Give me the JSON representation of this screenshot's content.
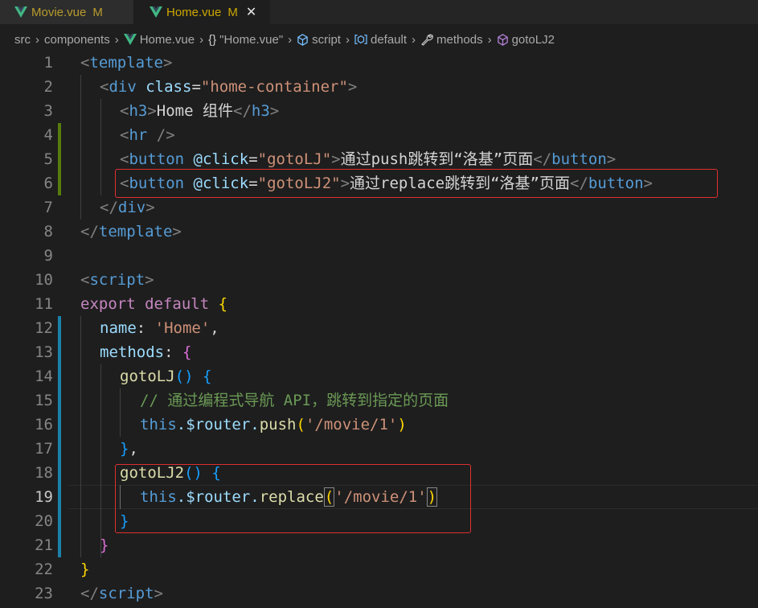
{
  "tabs": [
    {
      "title": "Movie.vue",
      "status": "M",
      "active": false
    },
    {
      "title": "Home.vue",
      "status": "M",
      "active": true,
      "close": "✕"
    }
  ],
  "breadcrumb": {
    "items": [
      "src",
      "components",
      "Home.vue",
      "\"Home.vue\"",
      "script",
      "default",
      "methods",
      "gotoLJ2"
    ],
    "icons": [
      "",
      "",
      "vue-icon",
      "braces-icon",
      "cube-icon",
      "module-icon",
      "wrench-icon",
      "method-icon"
    ]
  },
  "colors": {
    "background": "#1e1e1e",
    "highlight_box": "#e03030",
    "modified_gutter_green": "#587c0c",
    "modified_gutter_blue": "#1b81a8"
  },
  "line_numbers": [
    "1",
    "2",
    "3",
    "4",
    "5",
    "6",
    "7",
    "8",
    "9",
    "10",
    "11",
    "12",
    "13",
    "14",
    "15",
    "16",
    "17",
    "18",
    "19",
    "20",
    "21",
    "22",
    "23"
  ],
  "current_line": "19",
  "code": {
    "l1_tag": "template",
    "l2_tag": "div",
    "l2_attr": "class",
    "l2_val": "\"home-container\"",
    "l3_tag": "h3",
    "l3_text": "Home 组件",
    "l4_tag": "hr",
    "l5_tag": "button",
    "l5_attr": "@click",
    "l5_val": "\"gotoLJ\"",
    "l5_text": "通过push跳转到“洛基”页面",
    "l6_val": "\"gotoLJ2\"",
    "l6_text": "通过replace跳转到“洛基”页面",
    "l7_tag": "div",
    "l8_tag": "template",
    "l10_tag": "script",
    "l11_export": "export",
    "l11_default": "default",
    "l12_key": "name",
    "l12_val": "'Home'",
    "l13_key": "methods",
    "l14_fn": "gotoLJ",
    "l15_comment": "// 通过编程式导航 API，跳转到指定的页面",
    "l16_this": "this",
    "l16_router": ".$router.",
    "l16_method": "push",
    "l16_arg": "'/movie/1'",
    "l18_fn": "gotoLJ2",
    "l19_method": "replace",
    "l19_arg": "'/movie/1'",
    "l23_tag": "script"
  }
}
